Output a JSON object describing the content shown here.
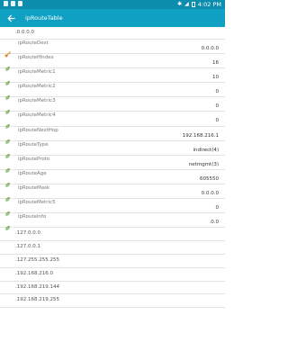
{
  "status": {
    "time": "4:02 PM"
  },
  "appbar": {
    "title": "ipRouteTable"
  },
  "top_item": {
    "label": ".0.0.0.0"
  },
  "attributes": [
    {
      "name": "ipRouteDest",
      "value": "0.0.0.0",
      "icon": "key-icon"
    },
    {
      "name": "ipRouteIfIndex",
      "value": "16",
      "icon": "leaf-icon"
    },
    {
      "name": "ipRouteMetric1",
      "value": "10",
      "icon": "leaf-icon"
    },
    {
      "name": "ipRouteMetric2",
      "value": "0",
      "icon": "leaf-icon"
    },
    {
      "name": "ipRouteMetric3",
      "value": "0",
      "icon": "leaf-icon"
    },
    {
      "name": "ipRouteMetric4",
      "value": "0",
      "icon": "leaf-icon"
    },
    {
      "name": "ipRouteNextHop",
      "value": "192.168.216.1",
      "icon": "leaf-icon"
    },
    {
      "name": "ipRouteType",
      "value": "indirect(4)",
      "icon": "leaf-icon"
    },
    {
      "name": "ipRouteProto",
      "value": "netmgmt(3)",
      "icon": "leaf-icon"
    },
    {
      "name": "ipRouteAge",
      "value": "605550",
      "icon": "leaf-icon"
    },
    {
      "name": "ipRouteMask",
      "value": "0.0.0.0",
      "icon": "leaf-icon"
    },
    {
      "name": "ipRouteMetric5",
      "value": "0",
      "icon": "leaf-icon"
    },
    {
      "name": "ipRouteInfo",
      "value": ".0.0",
      "icon": "leaf-icon"
    }
  ],
  "rows": [
    {
      "label": ".127.0.0.0"
    },
    {
      "label": ".127.0.0.1"
    },
    {
      "label": ".127.255.255.255"
    },
    {
      "label": ".192.168.216.0"
    },
    {
      "label": ".192.168.219.144"
    },
    {
      "label": ".192.168.219.255"
    }
  ],
  "colors": {
    "status_bar": "#0d8dad",
    "app_bar": "#0fa0c4",
    "leaf": "#7bb661",
    "key": "#e08a2e"
  }
}
